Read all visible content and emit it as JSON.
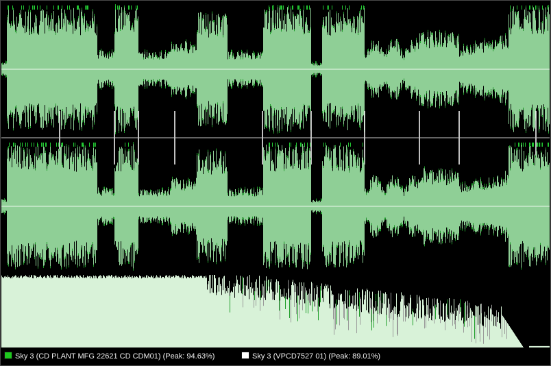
{
  "colors": {
    "background": "#000000",
    "wave_fill": "#8fcf96",
    "wave_edge": "#1f9e2a",
    "wave_peak": "#22c832",
    "overlay_peak": "#d9d9d9",
    "spectrum_fill": "#d8f2d8",
    "spectrum_overlay": "#9a9a9a",
    "center_line": "#ffffff",
    "separator": "#c8c8c8"
  },
  "legend": [
    {
      "label": "Sky 3 (CD PLANT MFG 22621 CD CDM01) (Peak: 94.63%)",
      "swatch_color": "#1ec81e"
    },
    {
      "label": "Sky 3 (VPCD7527 01) (Peak: 89.01%)",
      "swatch_color": "#ffffff"
    }
  ]
}
